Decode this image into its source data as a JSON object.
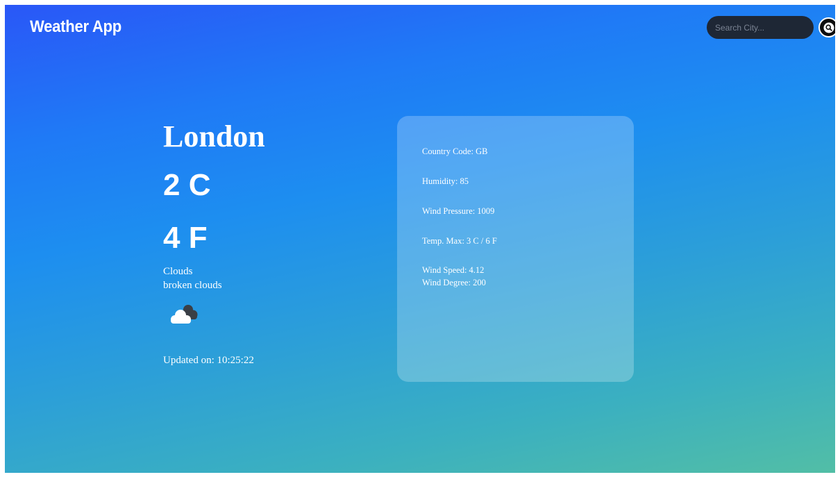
{
  "header": {
    "app_title": "Weather App",
    "search": {
      "placeholder": "Search City...",
      "value": ""
    },
    "search_button_icon": "search-icon"
  },
  "weather": {
    "city": "London",
    "temp_c": "2 C",
    "temp_f": "4 F",
    "condition": "Clouds",
    "description": "broken clouds",
    "icon": "broken-clouds-icon",
    "updated": "Updated on: 10:25:22"
  },
  "details": {
    "country_code": "Country Code: GB",
    "humidity": "Humidity: 85",
    "pressure": "Wind Pressure: 1009",
    "temp_max": "Temp. Max: 3 C / 6 F",
    "wind_speed": "Wind Speed: 4.12",
    "wind_degree": "Wind Degree: 200"
  },
  "colors": {
    "gradient_top": "#2a57f7",
    "gradient_bottom": "#52bea6",
    "search_bg": "#1e2735",
    "text": "#ffffff"
  }
}
